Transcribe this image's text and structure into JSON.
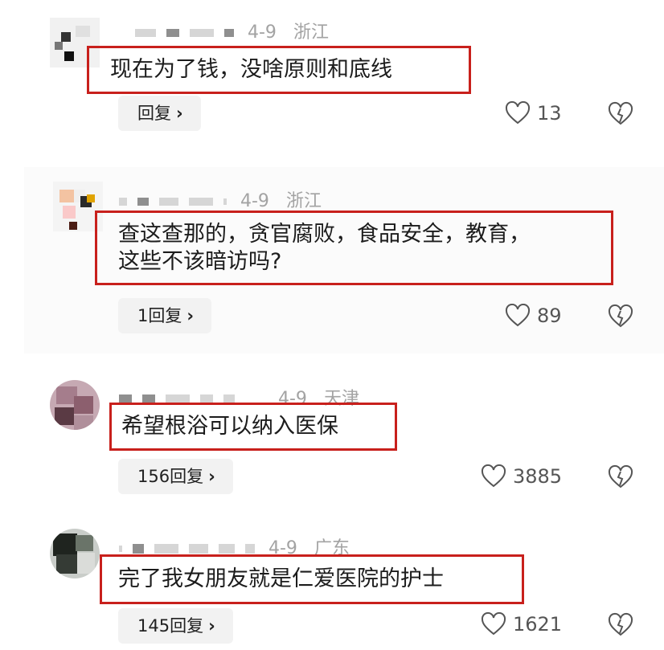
{
  "colors": {
    "highlight_border": "#c8201c",
    "meta_text": "#a3a3a3",
    "reply_bg": "#f2f2f2"
  },
  "comments": [
    {
      "date": "4-9",
      "location": "浙江",
      "text_lines": [
        "现在为了钱，没啥原则和底线"
      ],
      "reply_label": "回复",
      "likes": "13"
    },
    {
      "date": "4-9",
      "location": "浙江",
      "text_lines": [
        "查这查那的，贪官腐败，食品安全，教育，",
        "这些不该暗访吗?"
      ],
      "reply_label": "1回复",
      "likes": "89"
    },
    {
      "date": "4-9",
      "location": "天津",
      "text_lines": [
        "希望根浴可以纳入医保"
      ],
      "reply_label": "156回复",
      "likes": "3885"
    },
    {
      "date": "4-9",
      "location": "广东",
      "text_lines": [
        "完了我女朋友就是仁爱医院的护士"
      ],
      "reply_label": "145回复",
      "likes": "1621"
    }
  ],
  "icons": {
    "like": "heart-outline-icon",
    "dislike": "broken-heart-icon",
    "chevron": "chevron-right-icon"
  }
}
